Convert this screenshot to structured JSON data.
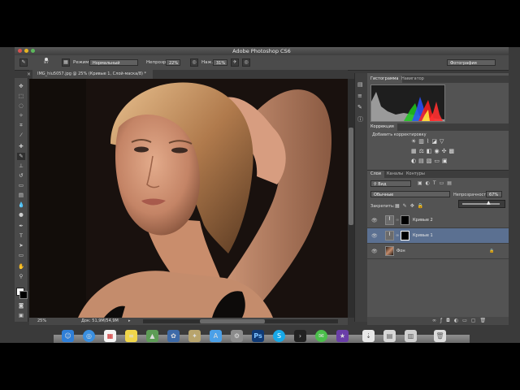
{
  "app": {
    "title": "Adobe Photoshop CS6"
  },
  "options_bar": {
    "brush_size": "87",
    "mode_label": "Режим:",
    "mode_value": "Нормальный",
    "opacity_label": "Непрозр.:",
    "opacity_value": "22%",
    "flow_label": "Наж.:",
    "flow_value": "31%",
    "workspace": "Фотография"
  },
  "document": {
    "tab_title": "IMG_hiu5057.jpg @ 25% (Кривые 1, Слой-маска/8) *",
    "zoom": "25%",
    "doc_info": "Док: 51,9M/54,9M"
  },
  "histogram_panel": {
    "tabs": [
      "Гистограмма",
      "Навигатор"
    ]
  },
  "adjustments_panel": {
    "title": "Коррекция",
    "subtitle": "Добавить корректировку"
  },
  "layers_panel": {
    "tabs": [
      "Слои",
      "Каналы",
      "Контуры"
    ],
    "filter_label": "Вид",
    "blend_mode": "Обычные",
    "opacity_label": "Непрозрачность:",
    "opacity_value": "67%",
    "lock_label": "Закрепить:",
    "layers": [
      {
        "name": "Кривые 2"
      },
      {
        "name": "Кривые 1"
      },
      {
        "name": "Фон"
      }
    ]
  },
  "colors": {
    "ps_blue": "#0f3a76",
    "selected_layer": "#5b7091"
  }
}
